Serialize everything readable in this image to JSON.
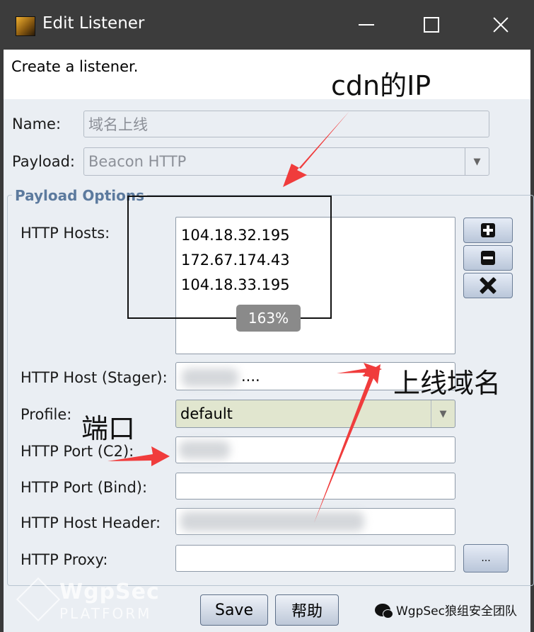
{
  "window": {
    "title": "Edit Listener"
  },
  "header": {
    "description": "Create a listener."
  },
  "form": {
    "name_label": "Name:",
    "name_value": "域名上线",
    "payload_label": "Payload:",
    "payload_value": "Beacon HTTP",
    "options_title": "Payload Options",
    "hosts_label": "HTTP Hosts:",
    "hosts": [
      "104.18.32.195",
      "172.67.174.43",
      "104.18.33.195"
    ],
    "stager_label": "HTTP Host (Stager):",
    "stager_value": "....",
    "profile_label": "Profile:",
    "profile_value": "default",
    "port_c2_label": "HTTP Port (C2):",
    "port_bind_label": "HTTP Port (Bind):",
    "host_header_label": "HTTP Host Header:",
    "proxy_label": "HTTP Proxy:",
    "proxy_button": "..."
  },
  "buttons": {
    "save": "Save",
    "help": "帮助"
  },
  "annotations": {
    "cdn_ip": "cdn的IP",
    "zoom": "163%",
    "online_domain": "上线域名",
    "port": "端口"
  },
  "watermark": {
    "brand": "WgpSec",
    "platform": "PLATFORM",
    "wechat": "WgpSec狼组安全团队"
  },
  "colors": {
    "titlebar": "#3c3c3c",
    "client_bg": "#eaeef3",
    "group_title": "#5c7a9e",
    "arrow_red": "#f03c3c",
    "profile_bg": "#e1e6cf"
  }
}
